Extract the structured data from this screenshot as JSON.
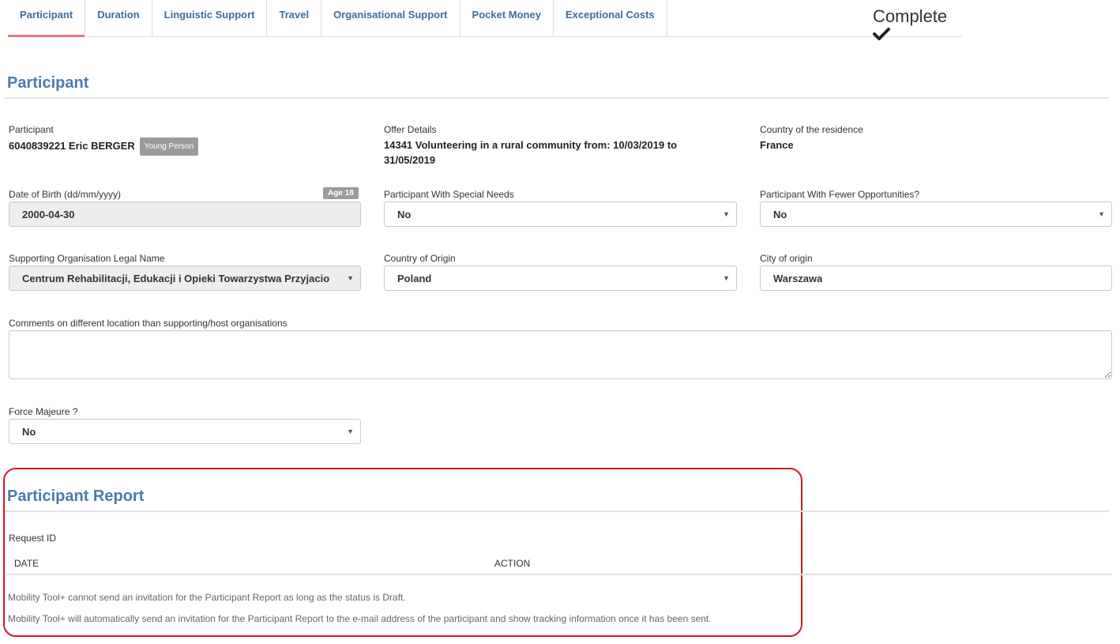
{
  "tabs": [
    {
      "label": "Participant",
      "active": true
    },
    {
      "label": "Duration",
      "active": false
    },
    {
      "label": "Linguistic Support",
      "active": false
    },
    {
      "label": "Travel",
      "active": false
    },
    {
      "label": "Organisational Support",
      "active": false
    },
    {
      "label": "Pocket Money",
      "active": false
    },
    {
      "label": "Exceptional Costs",
      "active": false
    }
  ],
  "status": {
    "label": "Complete",
    "icon": "checkmark-icon"
  },
  "participant_section": {
    "title": "Participant",
    "participant": {
      "label": "Participant",
      "value": "6040839221 Eric BERGER",
      "badge": "Young Person"
    },
    "offer": {
      "label": "Offer Details",
      "value": "14341 Volunteering in a rural community from: 10/03/2019 to 31/05/2019"
    },
    "residence": {
      "label": "Country of the residence",
      "value": "France"
    },
    "dob": {
      "label": "Date of Birth (dd/mm/yyyy)",
      "value": "2000-04-30",
      "age_badge": "Age 18"
    },
    "special_needs": {
      "label": "Participant With Special Needs",
      "value": "No"
    },
    "fewer_opportunities": {
      "label": "Participant With Fewer Opportunities?",
      "value": "No"
    },
    "supporting_org": {
      "label": "Supporting Organisation Legal Name",
      "value": "Centrum Rehabilitacji, Edukacji i Opieki Towarzystwa Przyjacio"
    },
    "country_origin": {
      "label": "Country of Origin",
      "value": "Poland"
    },
    "city_origin": {
      "label": "City of origin",
      "value": "Warszawa"
    },
    "comments": {
      "label": "Comments on different location than supporting/host organisations",
      "value": ""
    },
    "force_majeure": {
      "label": "Force Majeure ?",
      "value": "No"
    }
  },
  "report_section": {
    "title": "Participant Report",
    "request_id_label": "Request ID",
    "columns": [
      "DATE",
      "ACTION"
    ],
    "notes": [
      "Mobility Tool+ cannot send an invitation for the Participant Report as long as the status is Draft.",
      "Mobility Tool+ will automatically send an invitation for the Participant Report to the e-mail address of the participant and show tracking information once it has been sent."
    ]
  },
  "colors": {
    "accent": "#4b7bab",
    "tab_active_underline": "#e07b7b",
    "highlight_border": "#c81e1e"
  }
}
